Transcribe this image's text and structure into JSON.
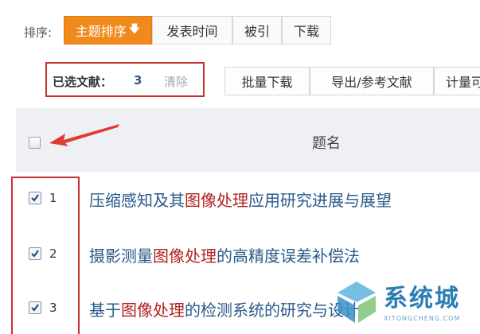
{
  "sort": {
    "label": "排序:",
    "buttons": [
      {
        "label": "主题排序",
        "active": true
      },
      {
        "label": "发表时间",
        "active": false
      },
      {
        "label": "被引",
        "active": false
      },
      {
        "label": "下载",
        "active": false
      }
    ]
  },
  "selection": {
    "label": "已选文献：",
    "count": "3",
    "clear": "清除"
  },
  "actions": {
    "batch_download": "批量下载",
    "export": "导出/参考文献",
    "quant": "计量可"
  },
  "table": {
    "header_title": "题名",
    "rows": [
      {
        "num": "1",
        "pre": "压缩感知及其",
        "hl": "图像处理",
        "post": "应用研究进展与展望",
        "checked": true
      },
      {
        "num": "2",
        "pre": "摄影测量",
        "hl": "图像处理",
        "post": "的高精度误差补偿法",
        "checked": true
      },
      {
        "num": "3",
        "pre": "基于",
        "hl": "图像处理",
        "post": "的检测系统的研究与设计",
        "checked": true
      }
    ]
  },
  "watermark": {
    "text": "系统城",
    "sub": "XITONGCHENG.COM"
  },
  "colors": {
    "accent": "#f08a1c",
    "link": "#2a5a8a",
    "highlight": "#b22222",
    "annotation": "#c9302c"
  }
}
